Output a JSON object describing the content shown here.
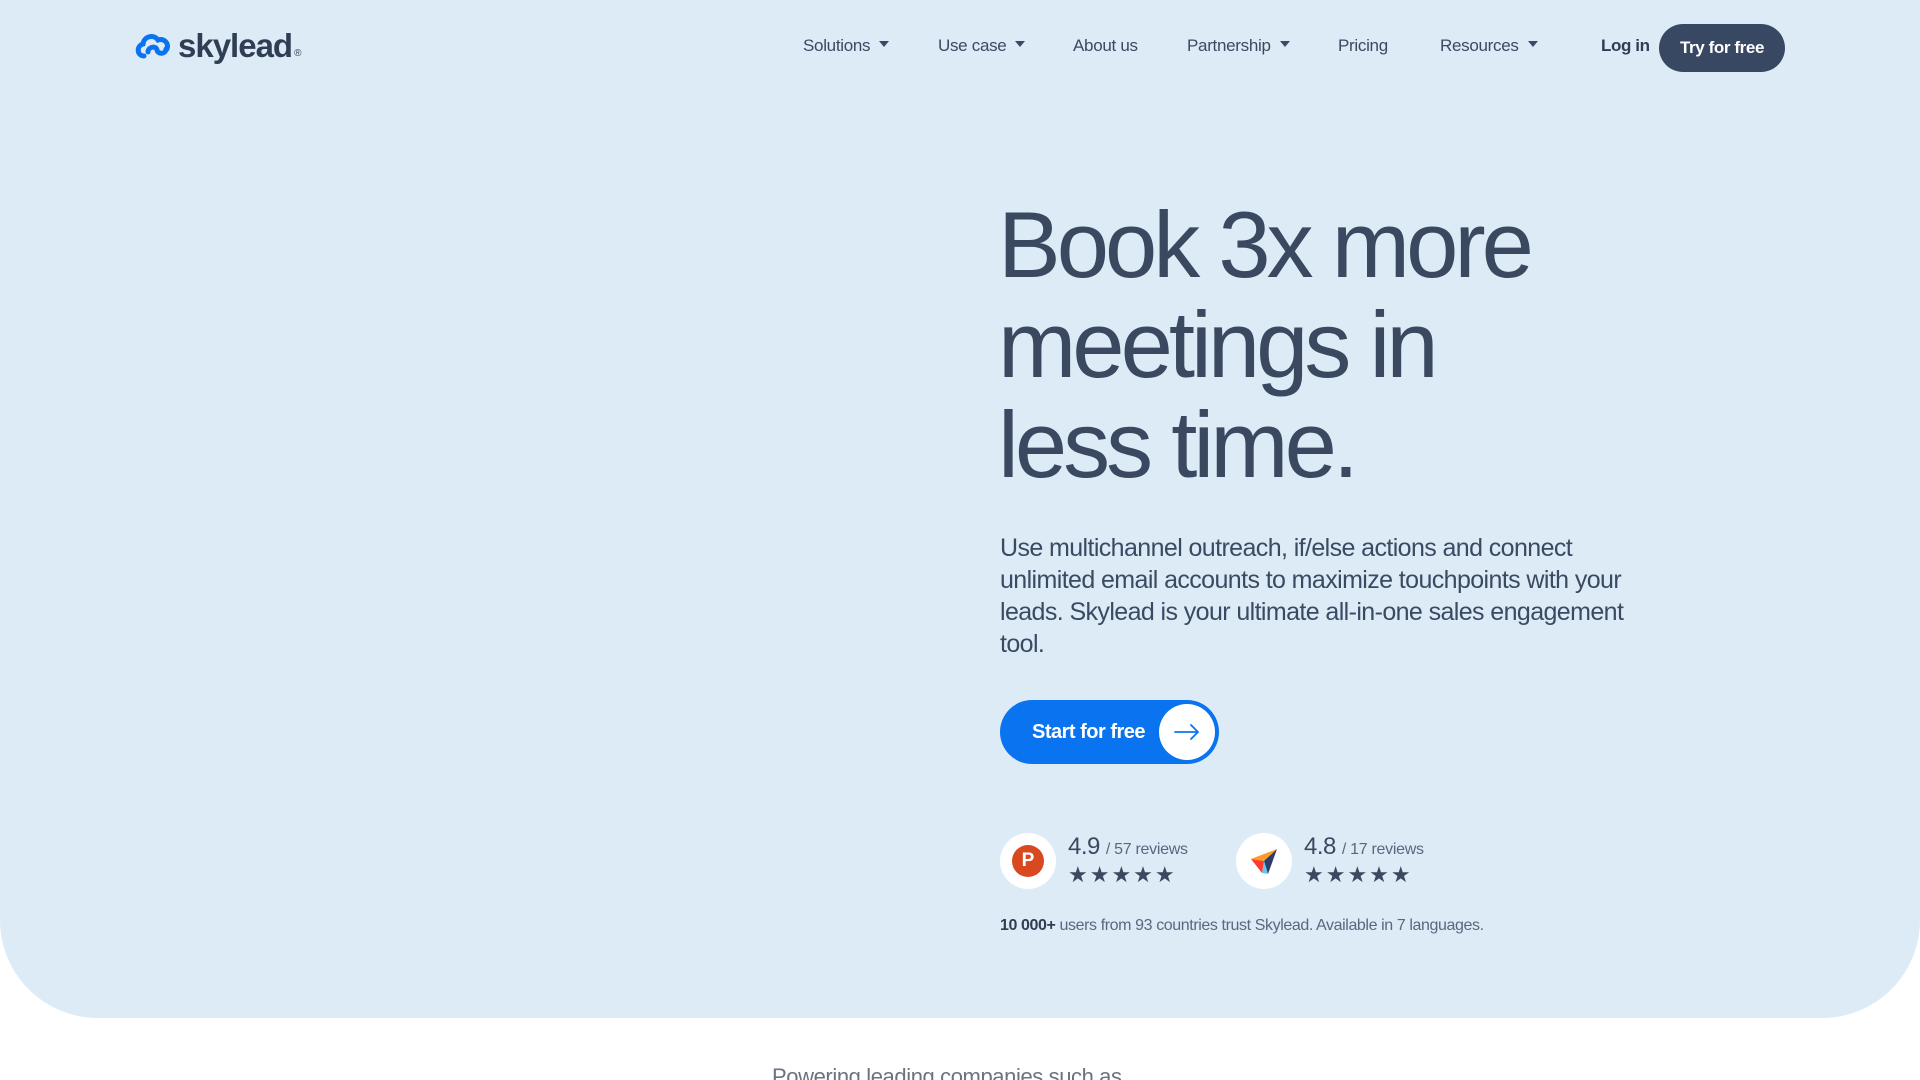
{
  "brand": {
    "name": "skylead",
    "registered": "®",
    "accent": "#0a74f0",
    "dark": "#394862",
    "hero_bg": "#dcebf5"
  },
  "nav": {
    "items": [
      {
        "label": "Solutions",
        "dropdown": true
      },
      {
        "label": "Use case",
        "dropdown": true
      },
      {
        "label": "About us",
        "dropdown": false
      },
      {
        "label": "Partnership",
        "dropdown": true
      },
      {
        "label": "Pricing",
        "dropdown": false
      },
      {
        "label": "Resources",
        "dropdown": true
      }
    ],
    "login": "Log in",
    "try": "Try for free"
  },
  "hero": {
    "headline_line1": "Book 3x more",
    "headline_line2": "meetings in",
    "headline_line3": "less time.",
    "subtext": "Use multichannel outreach, if/else actions and connect unlimited email accounts to maximize touchpoints with your leads. Skylead is your ultimate all-in-one sales engagement tool.",
    "cta": "Start for free",
    "ratings": [
      {
        "icon": "product-hunt-icon",
        "badge_letter": "P",
        "score": "4.9",
        "reviews": "/ 57 reviews",
        "stars": "★★★★★"
      },
      {
        "icon": "capterra-icon",
        "score": "4.8",
        "reviews": "/ 17 reviews",
        "stars": "★★★★★"
      }
    ],
    "trust_bold": "10 000+",
    "trust_rest": " users from 93 countries trust Skylead. Available in 7 languages."
  },
  "powering": "Powering leading companies such as"
}
